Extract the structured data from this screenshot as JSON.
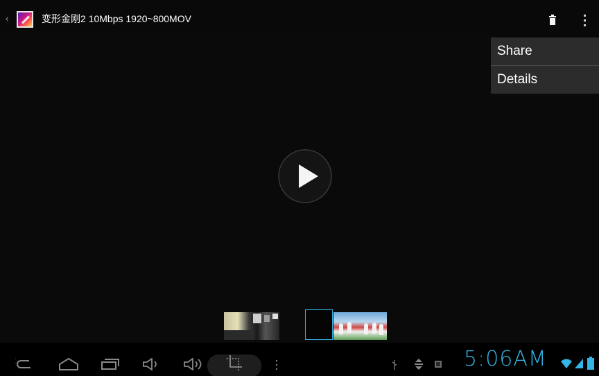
{
  "actionbar": {
    "up_caret": "‹",
    "app_icon": "gallery-photo-icon",
    "title": "变形金刚2 10Mbps 1920~800MOV",
    "delete_icon": "trash-icon",
    "overflow_icon": "overflow-menu-icon"
  },
  "menu": {
    "items": [
      {
        "label": "Share"
      },
      {
        "label": "Details"
      }
    ]
  },
  "player": {
    "play_icon": "play-icon"
  },
  "filmstrip": {
    "selected_index": 1,
    "thumbnails": [
      "video-frame-thumbnail",
      "selected-empty-thumbnail",
      "cheerleaders-thumbnail"
    ]
  },
  "navbar": {
    "buttons": [
      "back-icon",
      "home-icon",
      "recent-apps-icon",
      "volume-down-icon",
      "volume-up-icon",
      "screenshot-crop-icon",
      "menu-dots-icon"
    ]
  },
  "statusbar": {
    "icons": [
      "usb-icon",
      "usb-debug-icon",
      "sd-card-icon",
      "wifi-icon",
      "signal-icon",
      "battery-icon"
    ],
    "clock": "5:06AM"
  },
  "colors": {
    "background": "#0a0a0a",
    "menu_background": "#2c2c2c",
    "accent": "#33b5e5",
    "icon_gray": "#8a8a8a"
  }
}
